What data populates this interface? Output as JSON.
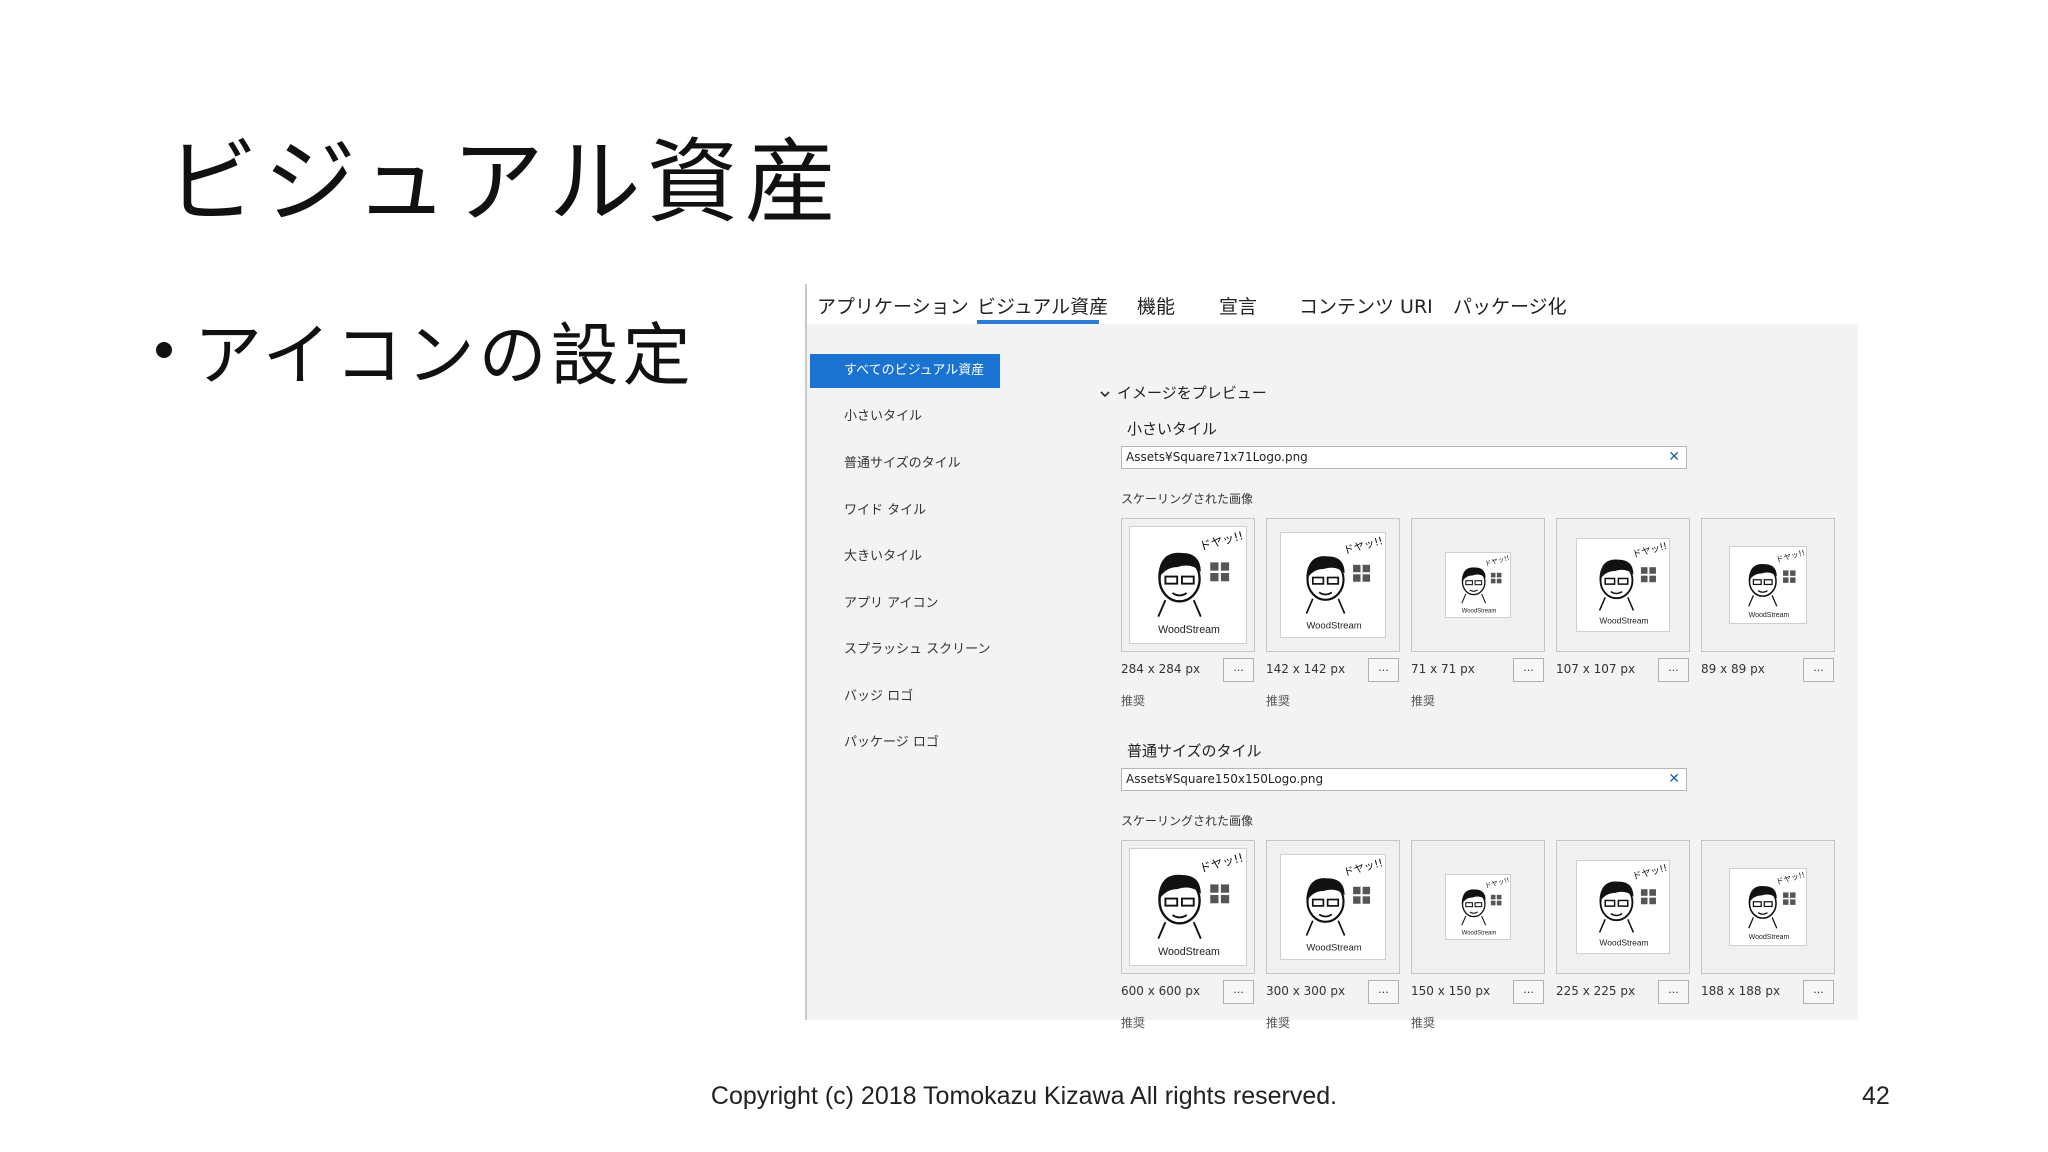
{
  "slide": {
    "title": "ビジュアル資産",
    "bullet": "アイコンの設定",
    "footer": "Copyright (c) 2018 Tomokazu Kizawa All rights reserved.",
    "page_number": "42"
  },
  "tabs": [
    "アプリケーション",
    "ビジュアル資産",
    "機能",
    "宣言",
    "コンテンツ URI",
    "パッケージ化"
  ],
  "active_tab": "ビジュアル資産",
  "sidebar": {
    "items": [
      "すべてのビジュアル資産",
      "小さいタイル",
      "普通サイズのタイル",
      "ワイド タイル",
      "大きいタイル",
      "アプリ アイコン",
      "スプラッシュ スクリーン",
      "バッジ ロゴ",
      "パッケージ ロゴ"
    ],
    "selected": "すべてのビジュアル資産"
  },
  "preview_toggle": "イメージをプレビュー",
  "sections": [
    {
      "title": "小さいタイル",
      "path": "Assets¥Square71x71Logo.png",
      "scaled_label": "スケーリングされた画像",
      "thumbs": [
        {
          "size": "284 x 284 px",
          "recommended": "推奨"
        },
        {
          "size": "142 x 142 px",
          "recommended": "推奨"
        },
        {
          "size": "71 x 71 px",
          "recommended": "推奨"
        },
        {
          "size": "107 x 107 px",
          "recommended": ""
        },
        {
          "size": "89 x 89 px",
          "recommended": ""
        }
      ]
    },
    {
      "title": "普通サイズのタイル",
      "path": "Assets¥Square150x150Logo.png",
      "scaled_label": "スケーリングされた画像",
      "thumbs": [
        {
          "size": "600 x 600 px",
          "recommended": "推奨"
        },
        {
          "size": "300 x 300 px",
          "recommended": "推奨"
        },
        {
          "size": "150 x 150 px",
          "recommended": "推奨"
        },
        {
          "size": "225 x 225 px",
          "recommended": ""
        },
        {
          "size": "188 x 188 px",
          "recommended": ""
        }
      ]
    }
  ],
  "clear_glyph": "✕",
  "more_glyph": "...",
  "logo": {
    "caption": "WoodStream",
    "bubble": "ドヤッ!!"
  },
  "colors": {
    "accent": "#1a73d1",
    "tab_underline": "#2a7bd3",
    "clear_icon": "#1b5fb4"
  }
}
